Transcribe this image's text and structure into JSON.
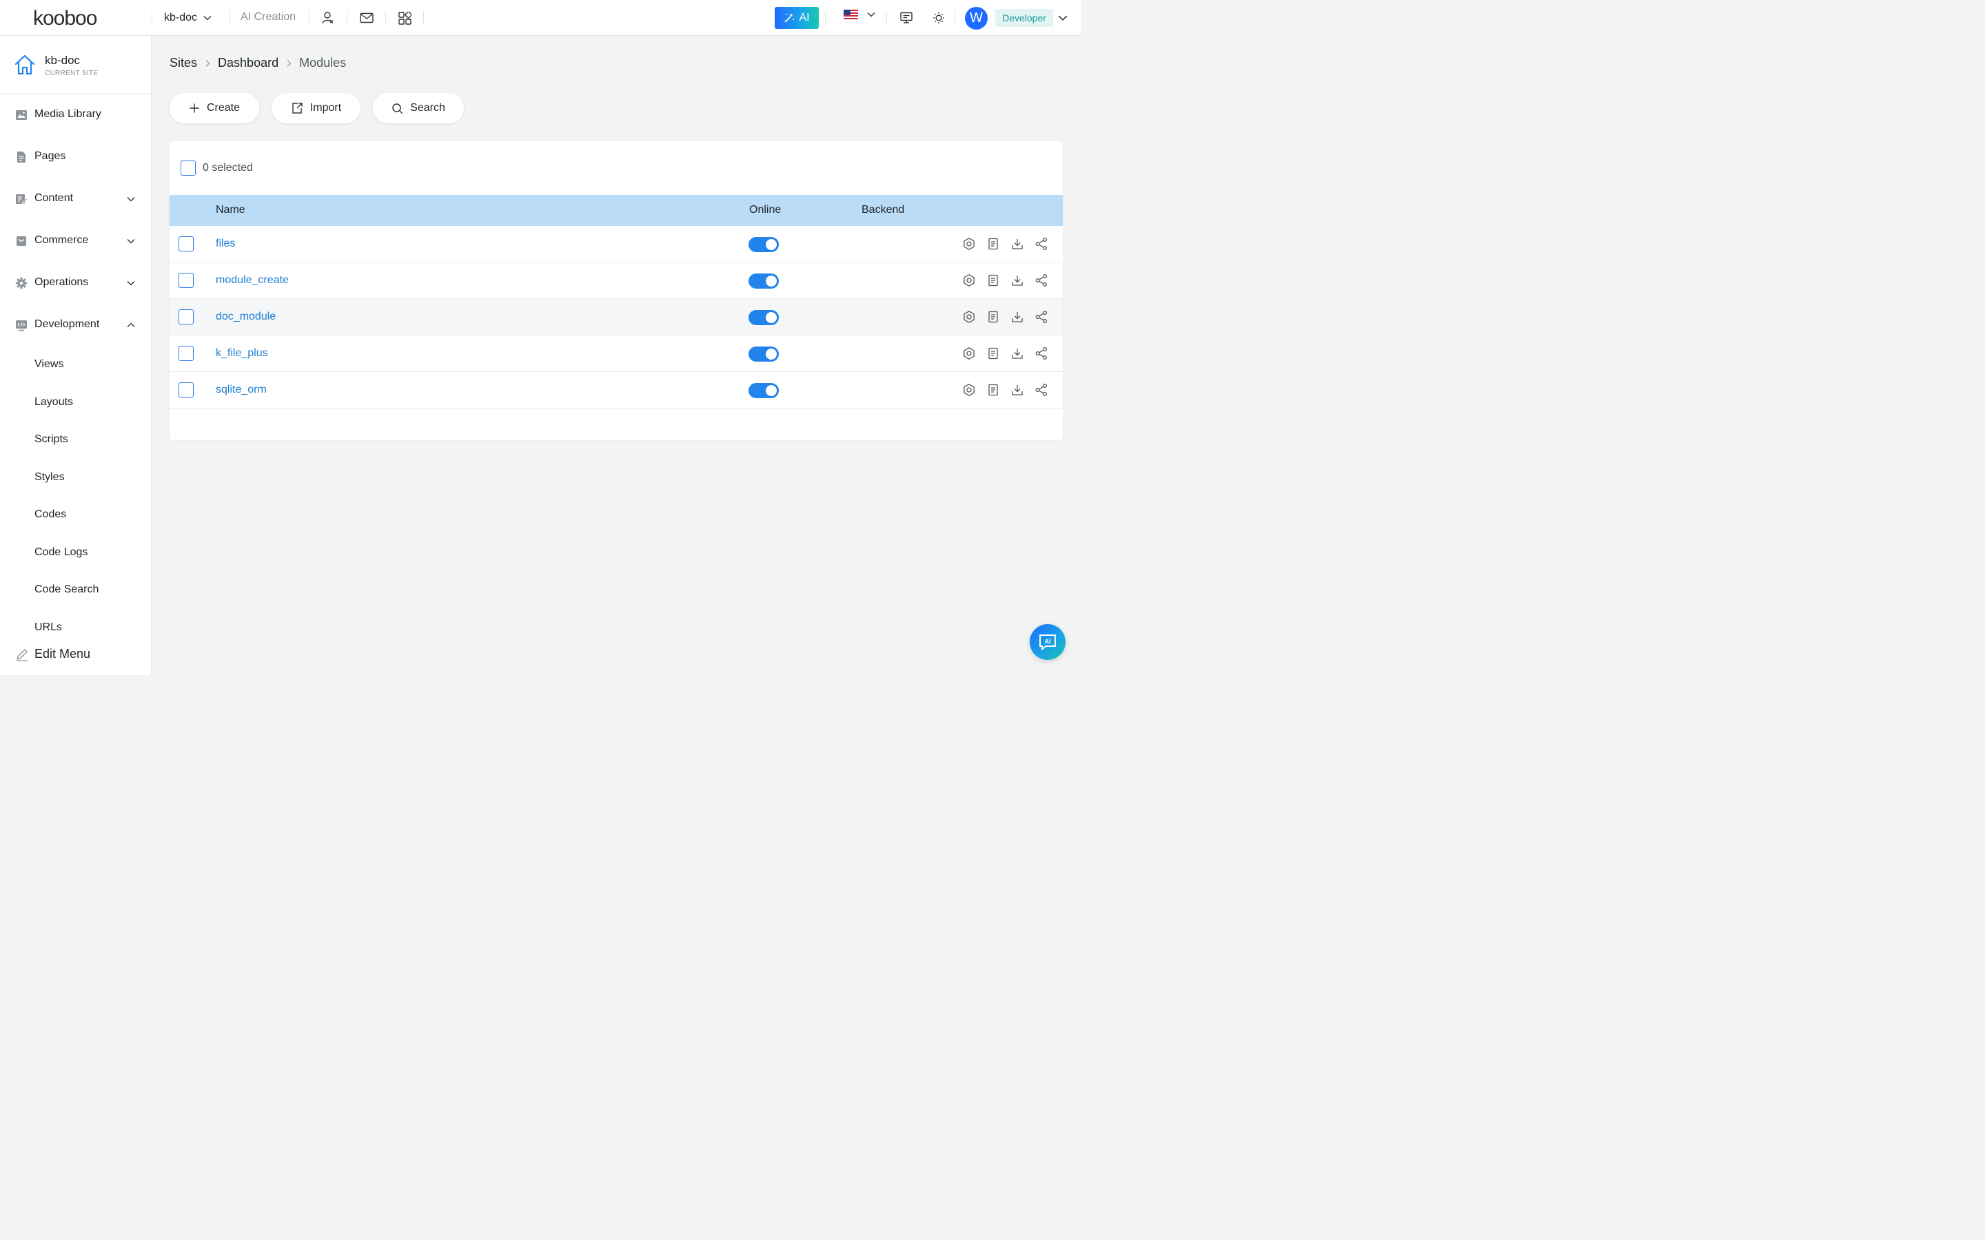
{
  "app": {
    "logo_text": "kooboo",
    "site_switch": "kb-doc",
    "ai_creation": "AI Creation",
    "ai_button": "AI",
    "avatar_letter": "W",
    "role": "Developer"
  },
  "sidebar": {
    "site_name": "kb-doc",
    "site_sub": "CURRENT SITE",
    "items": [
      {
        "label": "Media Library"
      },
      {
        "label": "Pages"
      },
      {
        "label": "Content"
      },
      {
        "label": "Commerce"
      },
      {
        "label": "Operations"
      },
      {
        "label": "Development"
      }
    ],
    "dev_sub": [
      "Views",
      "Layouts",
      "Scripts",
      "Styles",
      "Codes",
      "Code Logs",
      "Code Search",
      "URLs"
    ],
    "edit_menu": "Edit Menu"
  },
  "breadcrumb": [
    "Sites",
    "Dashboard",
    "Modules"
  ],
  "toolbar": {
    "create": "Create",
    "import": "Import",
    "search": "Search"
  },
  "table": {
    "selected_text": "0 selected",
    "columns": {
      "name": "Name",
      "online": "Online",
      "backend": "Backend"
    },
    "rows": [
      {
        "name": "files",
        "online": true
      },
      {
        "name": "module_create",
        "online": true
      },
      {
        "name": "doc_module",
        "online": true
      },
      {
        "name": "k_file_plus",
        "online": true
      },
      {
        "name": "sqlite_orm",
        "online": true
      }
    ]
  },
  "colors": {
    "accent": "#2184ec",
    "header_row": "#bbdcf6",
    "link": "#1f7fd6"
  }
}
